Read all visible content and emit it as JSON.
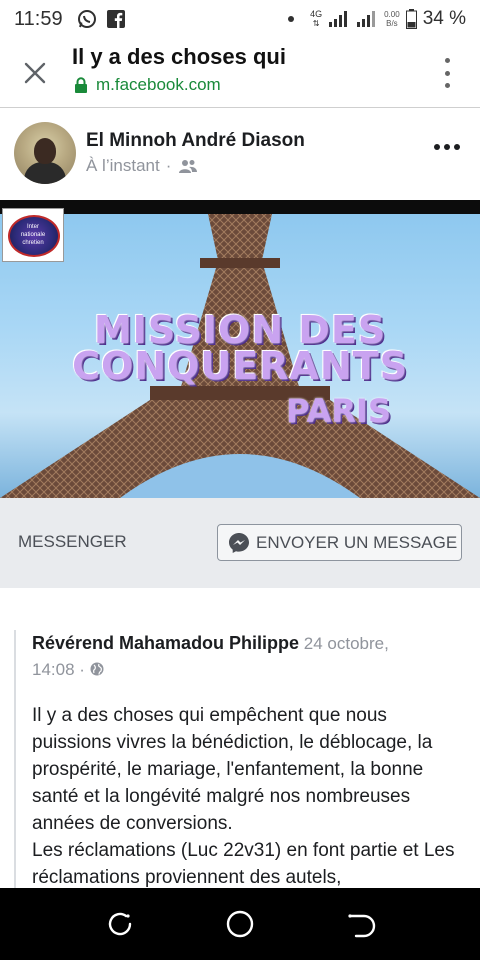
{
  "status_bar": {
    "time": "11:59",
    "left_icons": [
      "whatsapp-icon",
      "facebook-icon"
    ],
    "network_type": "4G",
    "speed_value": "0.00",
    "speed_unit": "B/s",
    "battery": "34 %"
  },
  "browser": {
    "page_title": "Il y a des choses qui",
    "url": "m.facebook.com",
    "colors": {
      "secure_green": "#1a8a3a"
    }
  },
  "post": {
    "author": "El Minnoh André Diason",
    "time": "À l’instant",
    "separator": "·",
    "audience_icon": "friends-icon"
  },
  "video": {
    "logo_text": [
      "Inter",
      "nationale",
      "chretien"
    ],
    "title_line_1": "MISSION DES",
    "title_line_2": "CONQUERANTS",
    "title_line_3": "PARIS"
  },
  "messenger": {
    "label": "MESSENGER",
    "button_label": "ENVOYER UN MESSAGE"
  },
  "shared_post": {
    "author": "Révérend Mahamadou Philippe",
    "date": "24 octobre,",
    "time": "14:08",
    "separator": "·",
    "audience_icon": "globe-icon",
    "body": "Il y a des choses qui empêchent que nous puissions vivres la bénédiction, le déblocage, la prospérité, le mariage, l'enfantement, la bonne santé et la longévité malgré nos nombreuses années de conversions.\nLes réclamations (Luc 22v31) en font partie et Les réclamations proviennent des autels,"
  },
  "nav": [
    "recents-button",
    "home-button",
    "back-button"
  ]
}
